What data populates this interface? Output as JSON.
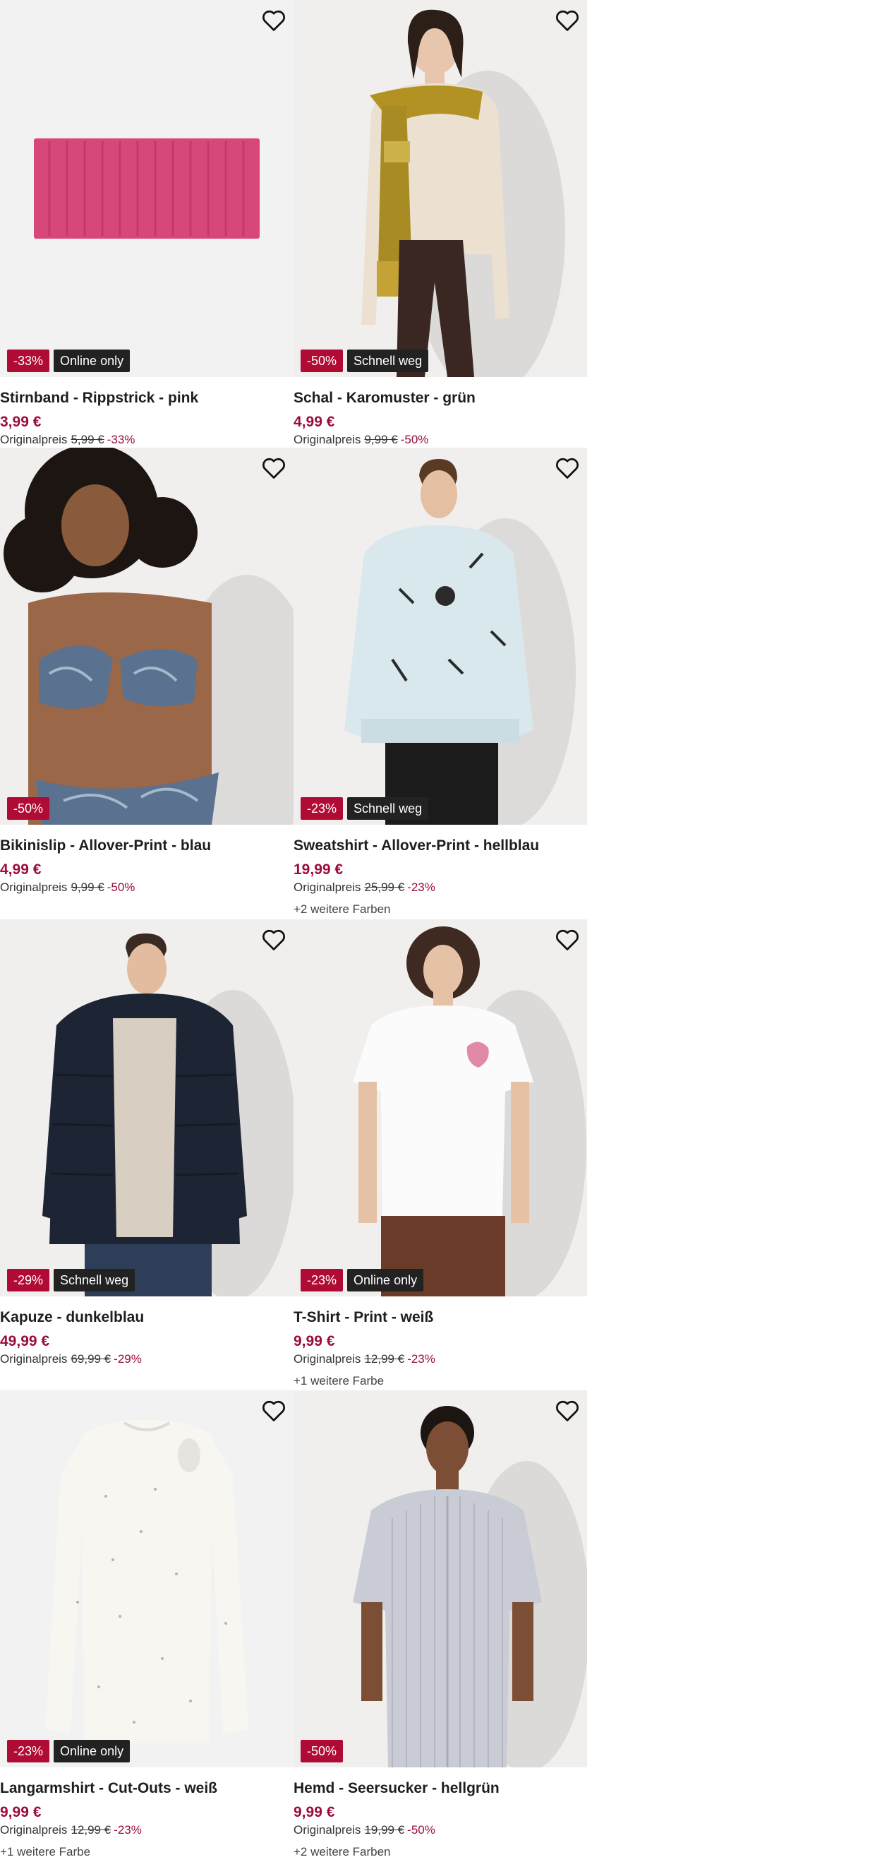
{
  "products": [
    {
      "title": "Stirnband - Rippstrick - pink",
      "price": "3,99 €",
      "orig_label": "Originalpreis",
      "orig_price": "5,99 €",
      "discount": "-33%",
      "tag": "Online only",
      "colors": ""
    },
    {
      "title": "Schal - Karomuster - grün",
      "price": "4,99 €",
      "orig_label": "Originalpreis",
      "orig_price": "9,99 €",
      "discount": "-50%",
      "tag": "Schnell weg",
      "colors": ""
    },
    {
      "title": "Bikinislip - Allover-Print - blau",
      "price": "4,99 €",
      "orig_label": "Originalpreis",
      "orig_price": "9,99 €",
      "discount": "-50%",
      "tag": "",
      "colors": ""
    },
    {
      "title": "Sweatshirt - Allover-Print - hellblau",
      "price": "19,99 €",
      "orig_label": "Originalpreis",
      "orig_price": "25,99 €",
      "discount": "-23%",
      "tag": "Schnell weg",
      "colors": "+2 weitere Farben"
    },
    {
      "title": "Kapuze - dunkelblau",
      "price": "49,99 €",
      "orig_label": "Originalpreis",
      "orig_price": "69,99 €",
      "discount": "-29%",
      "tag": "Schnell weg",
      "colors": ""
    },
    {
      "title": "T-Shirt - Print - weiß",
      "price": "9,99 €",
      "orig_label": "Originalpreis",
      "orig_price": "12,99 €",
      "discount": "-23%",
      "tag": "Online only",
      "colors": "+1 weitere Farbe"
    },
    {
      "title": "Langarmshirt - Cut-Outs - weiß",
      "price": "9,99 €",
      "orig_label": "Originalpreis",
      "orig_price": "12,99 €",
      "discount": "-23%",
      "tag": "Online only",
      "colors": "+1 weitere Farbe"
    },
    {
      "title": "Hemd - Seersucker - hellgrün",
      "price": "9,99 €",
      "orig_label": "Originalpreis",
      "orig_price": "19,99 €",
      "discount": "-50%",
      "tag": "",
      "colors": "+2 weitere Farben"
    }
  ],
  "icons": {
    "wishlist": "heart-outline-icon"
  },
  "colors": {
    "price": "#9b0d3a",
    "discount_badge": "#b00b34",
    "tag_badge": "#222222",
    "image_bg": "#efefef"
  }
}
